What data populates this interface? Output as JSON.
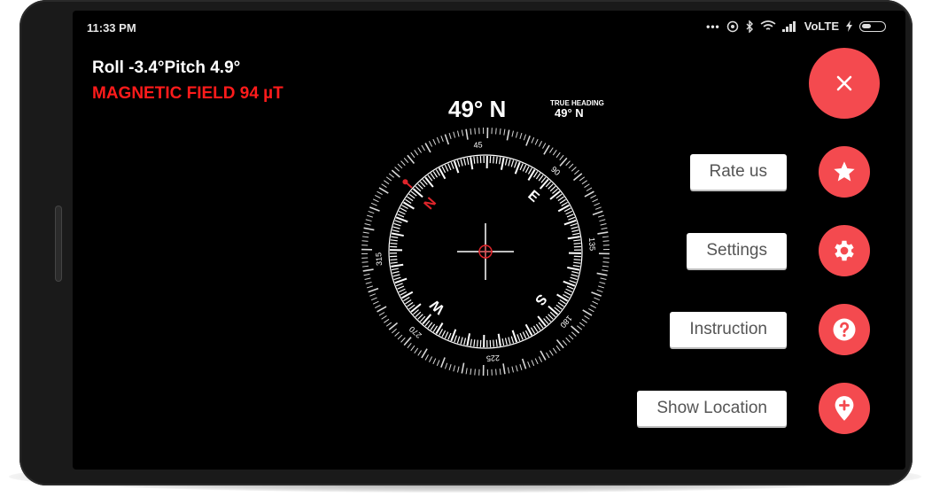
{
  "status_bar": {
    "time": "11:33 PM",
    "dots": "•••",
    "network": "VoLTE",
    "icons": [
      "hotspot-icon",
      "bluetooth-icon",
      "wifi-icon",
      "signal-icon",
      "charging-icon",
      "battery-icon"
    ]
  },
  "readouts": {
    "roll_pitch": "Roll -3.4°Pitch 4.9°",
    "magnetic_field": "MAGNETIC FIELD  94 µT"
  },
  "heading": {
    "main": "49° N",
    "true_heading_label": "TRUE HEADING",
    "true_heading_value": "49° N"
  },
  "compass": {
    "heading_deg": 49,
    "cardinals": [
      "N",
      "E",
      "S",
      "W"
    ],
    "degree_labels": [
      "45",
      "90",
      "135",
      "180",
      "225",
      "270",
      "315"
    ],
    "accent_color": "#e0252b"
  },
  "menu": {
    "close_icon": "close-icon",
    "items": [
      {
        "label": "Rate us",
        "icon": "star-icon"
      },
      {
        "label": "Settings",
        "icon": "gear-icon"
      },
      {
        "label": "Instruction",
        "icon": "question-icon"
      },
      {
        "label": "Show Location",
        "icon": "location-pin-icon"
      }
    ],
    "fab_color": "#f44a4f"
  }
}
